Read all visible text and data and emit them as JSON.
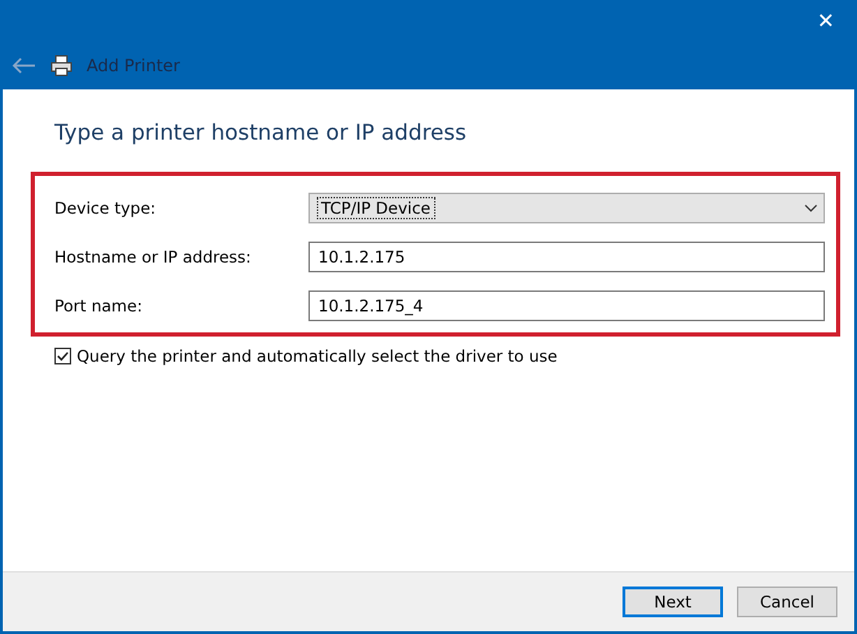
{
  "window": {
    "title": "Add Printer",
    "close": "✕"
  },
  "heading": "Type a printer hostname or IP address",
  "fields": [
    {
      "kind": "dropdown",
      "label": "Device type:",
      "value": "TCP/IP Device"
    },
    {
      "kind": "text",
      "label": "Hostname or IP address:",
      "value": "10.1.2.175"
    },
    {
      "kind": "text",
      "label": "Port name:",
      "value": "10.1.2.175_4"
    }
  ],
  "query_checkbox": {
    "label": "Query the printer and automatically select the driver to use",
    "checked": true
  },
  "buttons": [
    {
      "label": "Next",
      "default": true
    },
    {
      "label": "Cancel",
      "default": false
    }
  ]
}
